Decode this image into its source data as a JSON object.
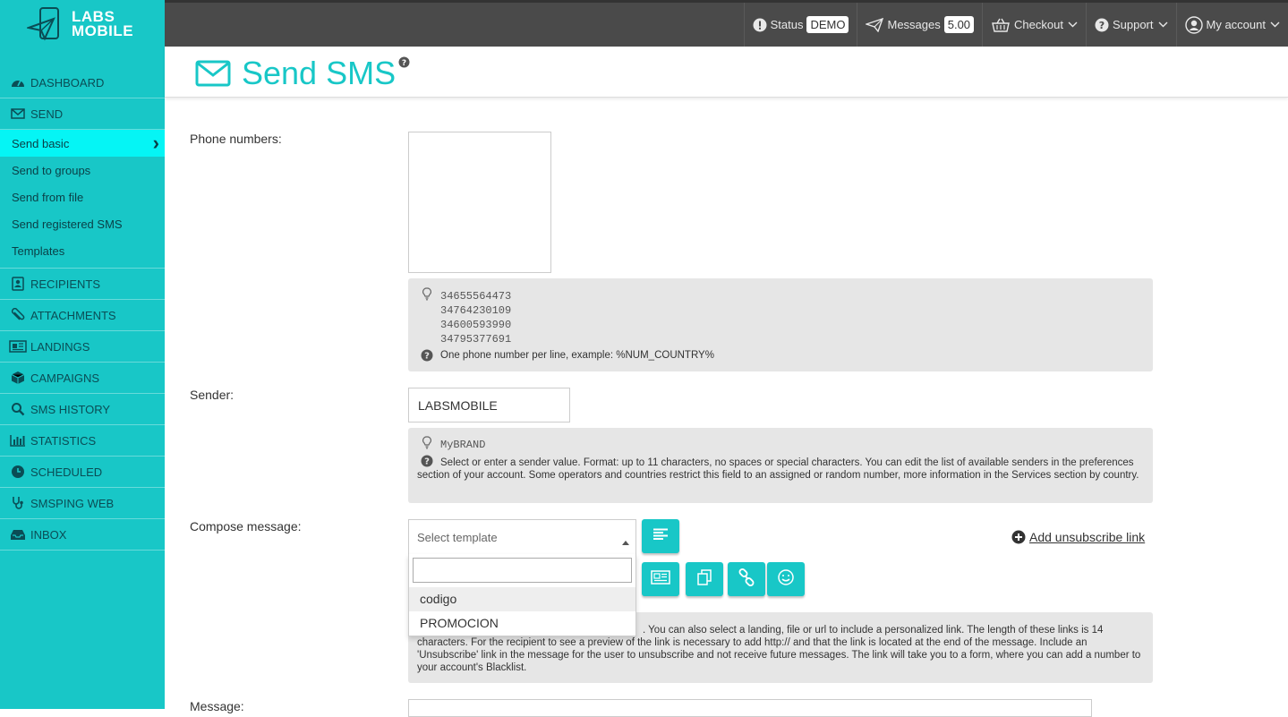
{
  "brand": {
    "line1": "LABS",
    "line2": "MOBILE"
  },
  "sidebar": {
    "items": [
      {
        "label": "DASHBOARD",
        "icon": "dashboard-icon"
      },
      {
        "label": "SEND",
        "icon": "envelope-icon"
      },
      {
        "label": "RECIPIENTS",
        "icon": "contact-icon"
      },
      {
        "label": "ATTACHMENTS",
        "icon": "paperclip-icon"
      },
      {
        "label": "LANDINGS",
        "icon": "newspaper-icon"
      },
      {
        "label": "CAMPAIGNS",
        "icon": "cube-icon"
      },
      {
        "label": "SMS HISTORY",
        "icon": "search-icon"
      },
      {
        "label": "STATISTICS",
        "icon": "bar-chart-icon"
      },
      {
        "label": "SCHEDULED",
        "icon": "clock-icon"
      },
      {
        "label": "SMSPING WEB",
        "icon": "stethoscope-icon"
      },
      {
        "label": "INBOX",
        "icon": "inbox-icon"
      }
    ],
    "send_sub": [
      "Send basic",
      "Send to groups",
      "Send from file",
      "Send registered SMS",
      "Templates"
    ]
  },
  "topbar": {
    "status_label": "Status",
    "status_value": "DEMO",
    "messages_label": "Messages",
    "messages_value": "5.00",
    "checkout_label": "Checkout",
    "support_label": "Support",
    "account_label": "My account"
  },
  "page": {
    "title": "Send SMS",
    "help": "?"
  },
  "form": {
    "phone_label": "Phone numbers:",
    "phone_examples": [
      "34655564473",
      "34764230109",
      "34600593990",
      "34795377691"
    ],
    "phone_help": "One phone number per line, example: %NUM_COUNTRY%",
    "sender_label": "Sender:",
    "sender_value": "LABSMOBILE",
    "sender_example": "MyBRAND",
    "sender_help": "Select or enter a sender value. Format: up to 11 characters, no spaces or special characters. You can edit the list of available senders in the preferences section of your account. Some operators and countries restrict this field to an assigned or random number, more information in the Services section by country.",
    "compose_label": "Compose message:",
    "template_placeholder": "Select template",
    "template_options": [
      "codigo",
      "PROMOCION"
    ],
    "unsubscribe_link": "Add unsubscribe link",
    "compose_help": ". You can also select a landing, file or url to include a personalized link. The length of these links is 14 characters. For the recipient to see a preview of the link is necessary to add http:// and that the link is located at the end of the message. Include an 'Unsubscribe' link in the message for the user to unsubscribe and not receive future messages. The link will take you to a form, where you can add a number to your account's Blacklist.",
    "message_label": "Message:"
  },
  "colors": {
    "accent": "#18c7c7",
    "active": "#05f5f5",
    "topbar": "#4a4a4a"
  }
}
